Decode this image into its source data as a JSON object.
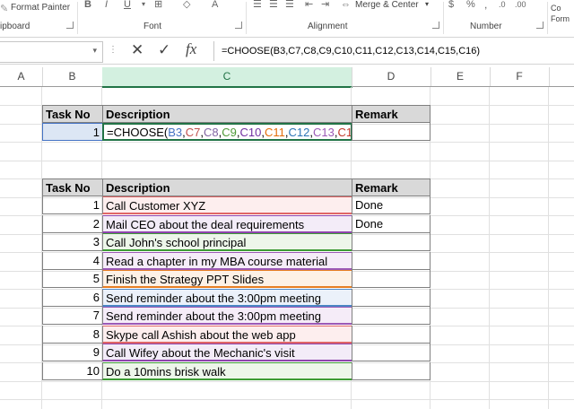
{
  "ribbon": {
    "format_painter": "Format Painter",
    "clipboard_label": "ipboard",
    "font_label": "Font",
    "alignment_label": "Alignment",
    "merge_center": "Merge & Center",
    "number_label": "Number",
    "bold": "B",
    "italic": "I",
    "underline": "U",
    "font_color": "A",
    "dollar": "$",
    "comma_style": "Co",
    "format_as": "Form"
  },
  "formula_bar": {
    "cancel": "✕",
    "enter": "✓",
    "fx": "fx",
    "formula": "=CHOOSE(B3,C7,C8,C9,C10,C11,C12,C13,C14,C15,C16)"
  },
  "columns": [
    "A",
    "B",
    "C",
    "D",
    "E",
    "F"
  ],
  "table1": {
    "headers": [
      "Task No",
      "Description",
      "Remark"
    ],
    "task_no": "1",
    "formula_prefix": "=CHOOSE(",
    "refs": [
      {
        "text": "B3",
        "color": "#4472c4"
      },
      {
        "text": "C7",
        "color": "#c0504d"
      },
      {
        "text": "C8",
        "color": "#8064a2"
      },
      {
        "text": "C9",
        "color": "#4f9a38"
      },
      {
        "text": "C10",
        "color": "#7030a0"
      },
      {
        "text": "C11",
        "color": "#e36c09"
      },
      {
        "text": "C12",
        "color": "#2e75b6"
      },
      {
        "text": "C13",
        "color": "#9b59b6"
      },
      {
        "text": "C14",
        "color": "#c0392b"
      },
      {
        "text": "C15",
        "color": "#4472c4"
      },
      {
        "text": "C16",
        "color": "#2e8b57"
      }
    ],
    "formula_suffix": ")"
  },
  "table2": {
    "headers": [
      "Task No",
      "Description",
      "Remark"
    ],
    "rows": [
      {
        "no": "1",
        "desc": "Call Customer XYZ",
        "remark": "Done",
        "bg": "#fdeeee",
        "line": "#e06666"
      },
      {
        "no": "2",
        "desc": "Mail CEO about the deal requirements",
        "remark": "Done",
        "bg": "#f3ecf8",
        "line": "#8e44ad"
      },
      {
        "no": "3",
        "desc": "Call John's school principal",
        "remark": "",
        "bg": "#edf6ea",
        "line": "#3d9b35"
      },
      {
        "no": "4",
        "desc": "Read a chapter in my MBA course material",
        "remark": "",
        "bg": "#f5ecf8",
        "line": "#9b59b6"
      },
      {
        "no": "5",
        "desc": "Finish the Strategy PPT Slides",
        "remark": "",
        "bg": "#fdf1e6",
        "line": "#e67e22"
      },
      {
        "no": "6",
        "desc": "Send reminder about the 3:00pm meeting",
        "remark": "",
        "bg": "#ebf1fa",
        "line": "#4a86c5"
      },
      {
        "no": "7",
        "desc": "Send reminder about the 3:00pm meeting",
        "remark": "",
        "bg": "#f5ecf8",
        "line": "#9b59b6"
      },
      {
        "no": "8",
        "desc": "Skype call Ashish about the web app",
        "remark": "",
        "bg": "#fdeeee",
        "line": "#e06666"
      },
      {
        "no": "9",
        "desc": "Call Wifey about the Mechanic's visit",
        "remark": "",
        "bg": "#f3ecf8",
        "line": "#8e44ad"
      },
      {
        "no": "10",
        "desc": "Do a 10mins brisk walk",
        "remark": "",
        "bg": "#edf6ea",
        "line": "#3d9b35"
      }
    ]
  }
}
